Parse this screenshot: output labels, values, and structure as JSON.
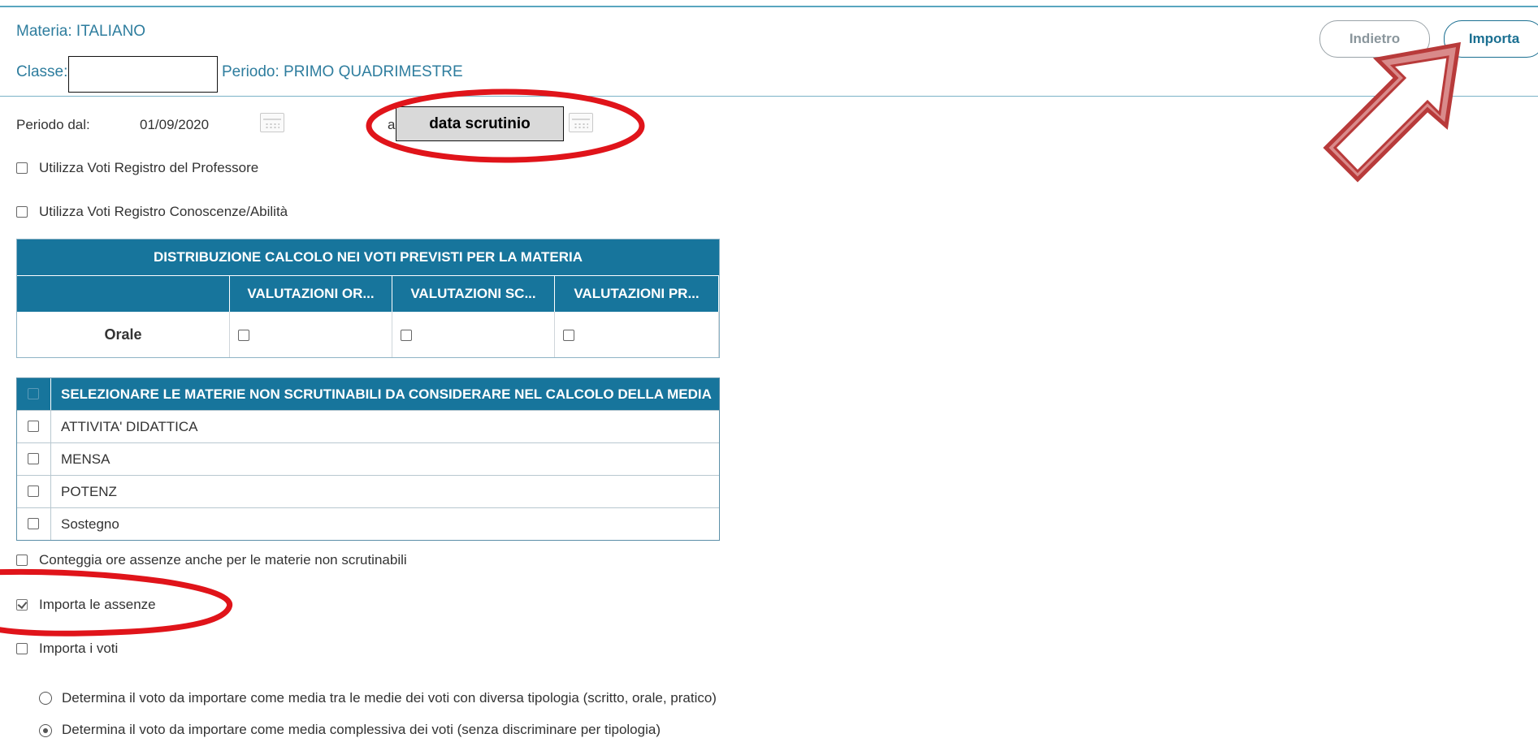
{
  "header": {
    "materia": "Materia: ITALIANO",
    "classe_label": "Classe:",
    "periodo": "Periodo: PRIMO QUADRIMESTRE"
  },
  "buttons": {
    "back": "Indietro",
    "import": "Importa"
  },
  "period": {
    "from_label": "Periodo dal:",
    "from_value": "01/09/2020",
    "to_label": "a",
    "to_value": "data scrutinio"
  },
  "options": {
    "use_prof_register": "Utilizza Voti Registro del Professore",
    "use_knowledge_register": "Utilizza Voti Registro Conoscenze/Abilità",
    "count_absences": "Conteggia ore assenze anche per le materie non scrutinabili",
    "import_absences": "Importa le assenze",
    "import_grades": "Importa i voti"
  },
  "distribution_table": {
    "title": "DISTRIBUZIONE CALCOLO NEI VOTI PREVISTI PER LA MATERIA",
    "columns": [
      "",
      "VALUTAZIONI OR...",
      "VALUTAZIONI SC...",
      "VALUTAZIONI PR..."
    ],
    "rows": [
      {
        "label": "Orale"
      }
    ]
  },
  "subjects_table": {
    "title": "SELEZIONARE LE MATERIE NON SCRUTINABILI DA CONSIDERARE NEL CALCOLO DELLA MEDIA",
    "rows": [
      "ATTIVITA' DIDATTICA",
      "MENSA",
      "POTENZ",
      "Sostegno"
    ]
  },
  "grade_mode": {
    "by_type": "Determina il voto da importare come media tra le medie dei voti con diversa tipologia (scritto, orale, pratico)",
    "overall": "Determina il voto da importare come media complessiva dei voti (senza discriminare per tipologia)"
  },
  "colors": {
    "accent": "#17759c",
    "annotation": "#e0141a",
    "arrow": "#b83a3a"
  }
}
